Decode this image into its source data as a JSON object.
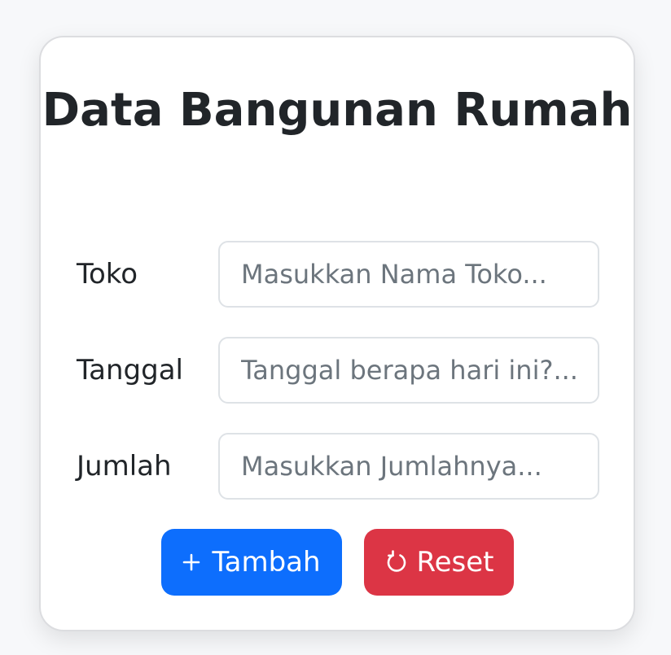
{
  "form": {
    "title": "Data Bangunan Rumah",
    "fields": [
      {
        "label": "Toko",
        "placeholder": "Masukkan Nama Toko...",
        "value": ""
      },
      {
        "label": "Tanggal",
        "placeholder": "Tanggal berapa hari ini?...",
        "value": ""
      },
      {
        "label": "Jumlah",
        "placeholder": "Masukkan Jumlahnya...",
        "value": ""
      }
    ],
    "buttons": {
      "add": {
        "label": "Tambah",
        "icon": "plus-icon",
        "color": "#0d6efd"
      },
      "reset": {
        "label": "Reset",
        "icon": "reset-icon",
        "color": "#dc3545"
      }
    }
  }
}
